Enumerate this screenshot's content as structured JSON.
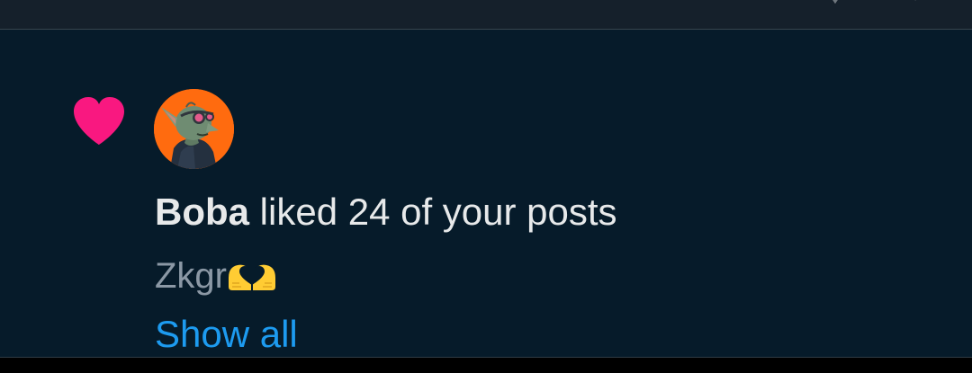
{
  "notification": {
    "user": {
      "name": "Boba"
    },
    "action_text": " liked 24 of your posts",
    "post_snippet": "Zkgr",
    "show_all_label": "Show all"
  },
  "icons": {
    "type_icon": "heart-icon",
    "snippet_emoji": "heart-hands-emoji"
  },
  "colors": {
    "background": "#061b2a",
    "heart": "#f91880",
    "link": "#1d9bf0",
    "text_primary": "#e7e9ea",
    "text_secondary": "#8b98a5",
    "avatar_bg": "#ff6b0f"
  }
}
